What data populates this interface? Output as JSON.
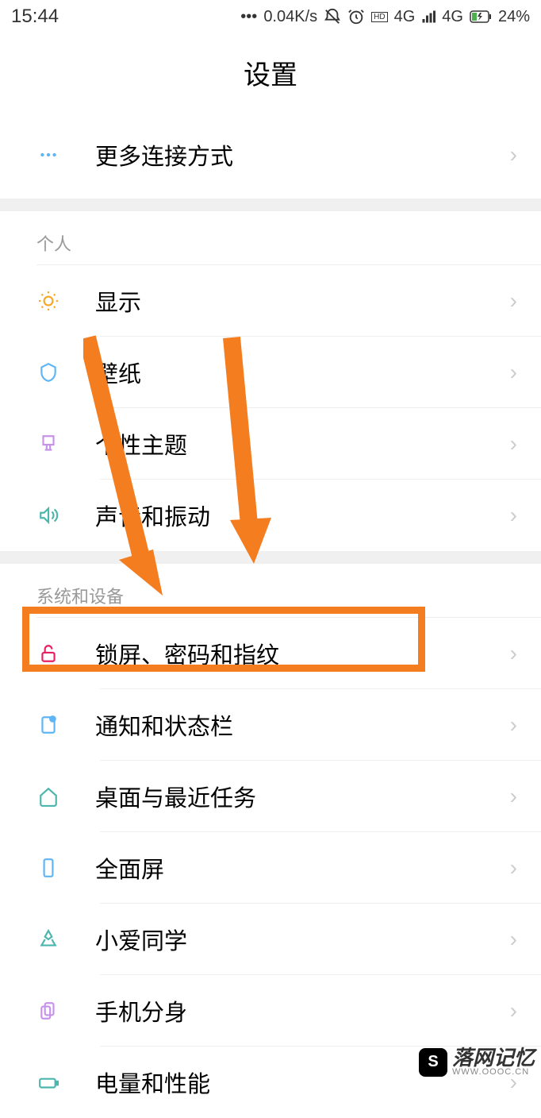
{
  "status_bar": {
    "time": "15:44",
    "speed": "0.04K/s",
    "network1": "4G",
    "network2": "4G",
    "battery": "24%"
  },
  "header": {
    "title": "设置"
  },
  "top_item": {
    "label": "更多连接方式"
  },
  "section_personal": {
    "title": "个人",
    "items": [
      {
        "label": "显示",
        "icon": "sun"
      },
      {
        "label": "壁纸",
        "icon": "shield"
      },
      {
        "label": "个性主题",
        "icon": "brush"
      },
      {
        "label": "声音和振动",
        "icon": "volume"
      }
    ]
  },
  "section_system": {
    "title": "系统和设备",
    "items": [
      {
        "label": "锁屏、密码和指纹",
        "icon": "lock"
      },
      {
        "label": "通知和状态栏",
        "icon": "notification"
      },
      {
        "label": "桌面与最近任务",
        "icon": "home"
      },
      {
        "label": "全面屏",
        "icon": "phone"
      },
      {
        "label": "小爱同学",
        "icon": "ai"
      },
      {
        "label": "手机分身",
        "icon": "copy"
      },
      {
        "label": "电量和性能",
        "icon": "battery"
      }
    ]
  },
  "watermark": {
    "title": "落网记忆",
    "url": "WWW.OOOC.CN"
  },
  "annotation": {
    "highlight_color": "#f47d20",
    "highlighted_item": "锁屏、密码和指纹"
  }
}
